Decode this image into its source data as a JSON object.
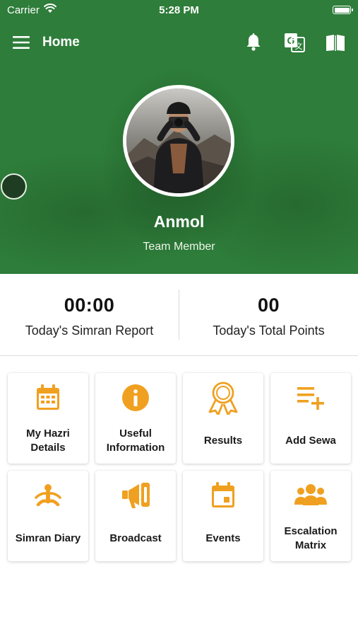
{
  "status_bar": {
    "carrier": "Carrier",
    "time": "5:28 PM"
  },
  "app_bar": {
    "title": "Home",
    "menu_icon": "hamburger-menu-icon",
    "actions": [
      "bell-icon",
      "translate-icon",
      "book-icon"
    ]
  },
  "profile": {
    "name": "Anmol",
    "role": "Team Member"
  },
  "stats": [
    {
      "value": "00:00",
      "label": "Today's Simran Report"
    },
    {
      "value": "00",
      "label": "Today's Total Points"
    }
  ],
  "tiles": [
    {
      "label": "My Hazri Details",
      "icon": "calendar-icon"
    },
    {
      "label": "Useful Information",
      "icon": "info-icon"
    },
    {
      "label": "Results",
      "icon": "award-ribbon-icon"
    },
    {
      "label": "Add Sewa",
      "icon": "playlist-add-icon"
    },
    {
      "label": "Simran Diary",
      "icon": "meditation-icon"
    },
    {
      "label": "Broadcast",
      "icon": "megaphone-icon"
    },
    {
      "label": "Events",
      "icon": "event-calendar-icon"
    },
    {
      "label": "Escalation Matrix",
      "icon": "group-people-icon"
    }
  ],
  "colors": {
    "header_green": "#2e7d3a",
    "accent_orange": "#f0a020",
    "text_dark": "#111111"
  }
}
